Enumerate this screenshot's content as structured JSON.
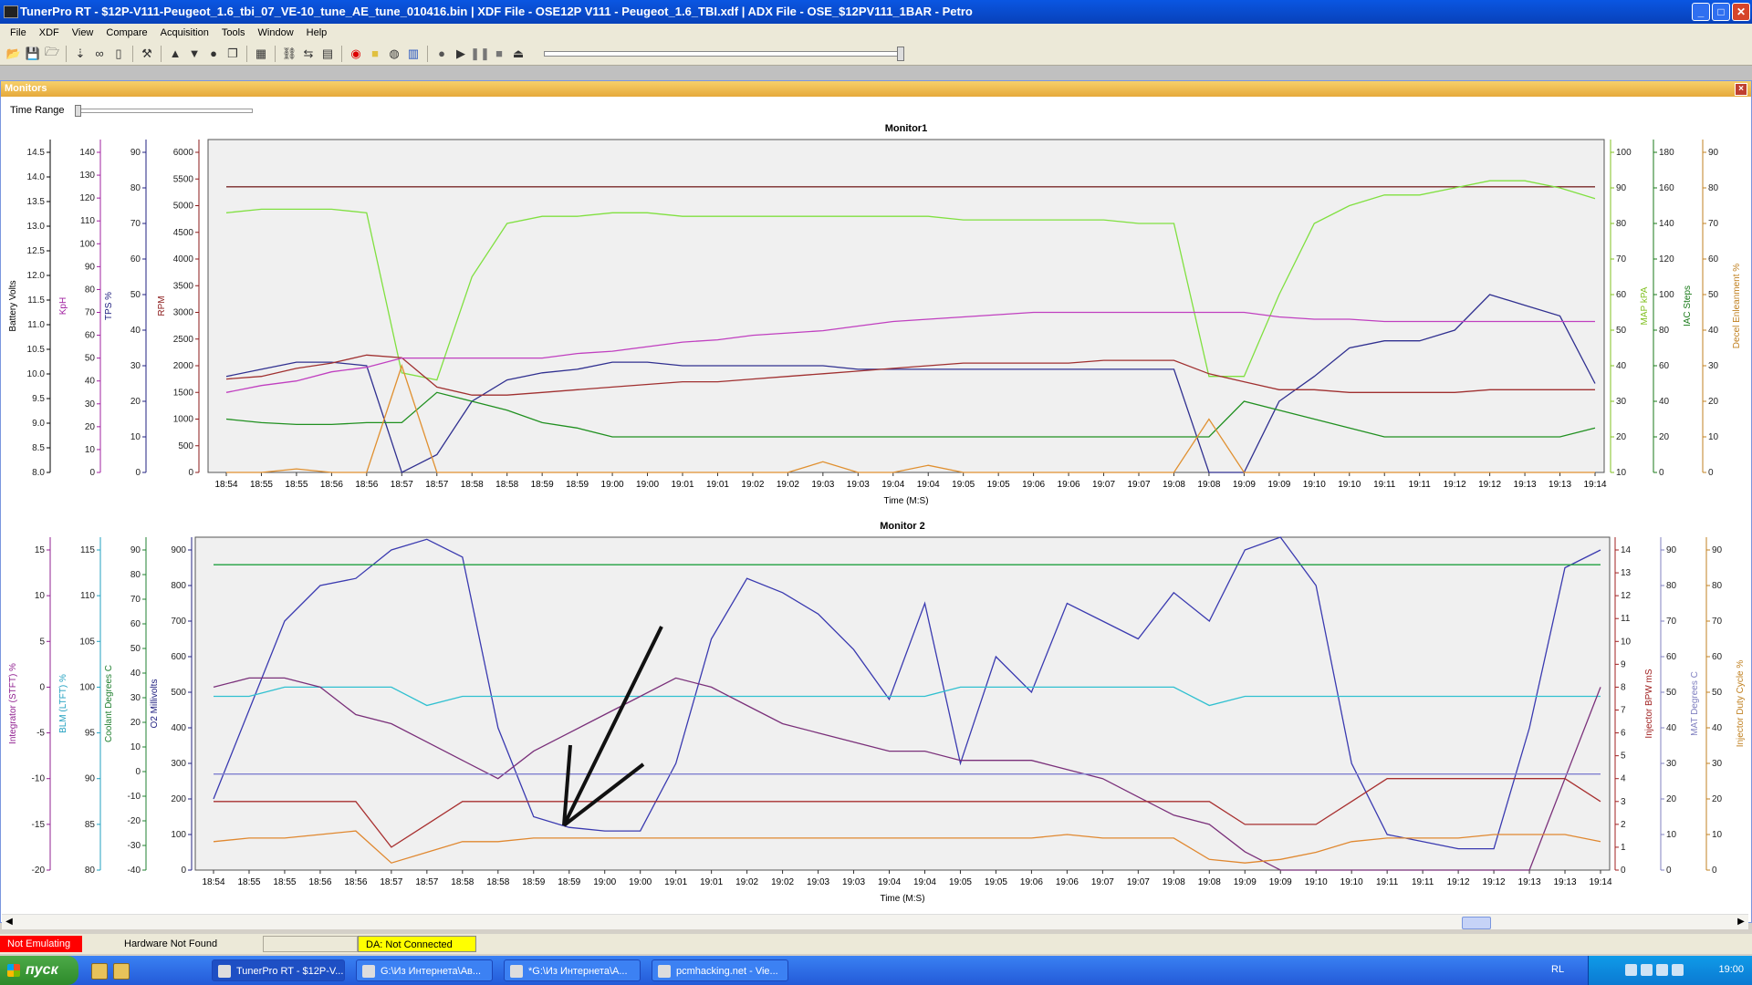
{
  "window": {
    "title": "TunerPro RT - $12P-V111-Peugeot_1.6_tbi_07_VE-10_tune_AE_tune_010416.bin | XDF File - OSE12P V111 - Peugeot_1.6_TBI.xdf | ADX File - OSE_$12PV111_1BAR - Petro"
  },
  "menu": [
    "File",
    "XDF",
    "View",
    "Compare",
    "Acquisition",
    "Tools",
    "Window",
    "Help"
  ],
  "monitors_panel": {
    "title": "Monitors",
    "time_range_label": "Time Range"
  },
  "chart_data": [
    {
      "type": "line",
      "title": "Monitor1",
      "xlabel": "Time (M:S)",
      "x": [
        "18:54",
        "18:55",
        "18:55",
        "18:56",
        "18:56",
        "18:57",
        "18:57",
        "18:58",
        "18:58",
        "18:59",
        "18:59",
        "19:00",
        "19:00",
        "19:01",
        "19:01",
        "19:02",
        "19:02",
        "19:03",
        "19:03",
        "19:04",
        "19:04",
        "19:05",
        "19:05",
        "19:06",
        "19:06",
        "19:07",
        "19:07",
        "19:08",
        "19:08",
        "19:09",
        "19:09",
        "19:10",
        "19:10",
        "19:11",
        "19:11",
        "19:12",
        "19:12",
        "19:13",
        "19:13",
        "19:14"
      ],
      "left_axes": [
        {
          "label": "Battery Volts",
          "color": "#000000",
          "ticks": [
            "14.5",
            "14.0",
            "13.5",
            "13.0",
            "12.5",
            "12.0",
            "11.5",
            "11.0",
            "10.5",
            "10.0",
            "9.5",
            "9.0",
            "8.5",
            "8.0"
          ]
        },
        {
          "label": "KpH",
          "color": "#a020a0",
          "ticks": [
            "140",
            "130",
            "120",
            "110",
            "100",
            "90",
            "80",
            "70",
            "60",
            "50",
            "40",
            "30",
            "20",
            "10",
            "0"
          ]
        },
        {
          "label": "TPS %",
          "color": "#202080",
          "ticks": [
            "90",
            "80",
            "70",
            "60",
            "50",
            "40",
            "30",
            "20",
            "10",
            "0"
          ]
        },
        {
          "label": "RPM",
          "color": "#8b1a1a",
          "ticks": [
            "6000",
            "5500",
            "5000",
            "4500",
            "4000",
            "3500",
            "3000",
            "2500",
            "2000",
            "1500",
            "1000",
            "500",
            "0"
          ]
        }
      ],
      "right_axes": [
        {
          "label": "MAP kPA",
          "color": "#80c020",
          "ticks": [
            "100",
            "90",
            "80",
            "70",
            "60",
            "50",
            "40",
            "30",
            "20",
            "10"
          ]
        },
        {
          "label": "IAC Steps",
          "color": "#1a7a1a",
          "ticks": [
            "180",
            "160",
            "140",
            "120",
            "100",
            "80",
            "60",
            "40",
            "20",
            "0"
          ]
        },
        {
          "label": "Decel Enleanment %",
          "color": "#c08020",
          "ticks": [
            "90",
            "80",
            "70",
            "60",
            "50",
            "40",
            "30",
            "20",
            "10",
            "0"
          ]
        }
      ],
      "series": [
        {
          "name": "Battery Volts",
          "color": "#7a2a2a",
          "values": [
            13.8,
            13.8,
            13.8,
            13.8,
            13.8,
            13.8,
            13.8,
            13.8,
            13.8,
            13.8,
            13.8,
            13.8,
            13.8,
            13.8,
            13.8,
            13.8,
            13.8,
            13.8,
            13.8,
            13.8,
            13.8,
            13.8,
            13.8,
            13.8,
            13.8,
            13.8,
            13.8,
            13.8,
            13.8,
            13.8,
            13.8,
            13.8,
            13.8,
            13.8,
            13.8,
            13.8,
            13.8,
            13.8,
            13.8,
            13.8
          ]
        },
        {
          "name": "MAP kPA",
          "color": "#80e040",
          "values": [
            83,
            84,
            84,
            84,
            83,
            38,
            36,
            65,
            80,
            82,
            82,
            83,
            83,
            82,
            82,
            82,
            82,
            82,
            82,
            82,
            82,
            81,
            81,
            81,
            81,
            81,
            80,
            80,
            37,
            37,
            60,
            80,
            85,
            88,
            88,
            90,
            92,
            92,
            90,
            87
          ]
        },
        {
          "name": "TPS %",
          "color": "#303090",
          "values": [
            27,
            29,
            31,
            31,
            30,
            0,
            5,
            20,
            26,
            28,
            29,
            31,
            31,
            30,
            30,
            30,
            30,
            30,
            29,
            29,
            29,
            29,
            29,
            29,
            29,
            29,
            29,
            29,
            0,
            0,
            20,
            27,
            35,
            37,
            37,
            40,
            50,
            47,
            44,
            25
          ]
        },
        {
          "name": "RPM",
          "color": "#a03030",
          "values": [
            1750,
            1800,
            1950,
            2050,
            2200,
            2150,
            1600,
            1450,
            1450,
            1500,
            1550,
            1600,
            1650,
            1700,
            1700,
            1750,
            1800,
            1850,
            1900,
            1950,
            2000,
            2050,
            2050,
            2050,
            2050,
            2100,
            2100,
            2100,
            1850,
            1700,
            1550,
            1550,
            1500,
            1500,
            1500,
            1500,
            1550,
            1550,
            1550,
            1550
          ]
        },
        {
          "name": "KpH",
          "color": "#c040c0",
          "values": [
            35,
            38,
            40,
            44,
            46,
            50,
            50,
            50,
            50,
            50,
            52,
            53,
            55,
            57,
            58,
            60,
            61,
            62,
            64,
            66,
            67,
            68,
            69,
            70,
            70,
            70,
            70,
            70,
            70,
            70,
            68,
            67,
            67,
            66,
            66,
            66,
            66,
            66,
            66,
            66
          ]
        },
        {
          "name": "IAC Steps",
          "color": "#209020",
          "values": [
            30,
            28,
            27,
            27,
            28,
            28,
            45,
            40,
            35,
            28,
            25,
            20,
            20,
            20,
            20,
            20,
            20,
            20,
            20,
            20,
            20,
            20,
            20,
            20,
            20,
            20,
            20,
            20,
            20,
            40,
            35,
            30,
            25,
            20,
            20,
            20,
            20,
            20,
            20,
            25
          ]
        },
        {
          "name": "Decel Enleanment %",
          "color": "#e09030",
          "values": [
            0,
            0,
            1,
            0,
            0,
            30,
            0,
            0,
            0,
            0,
            0,
            0,
            0,
            0,
            0,
            0,
            0,
            3,
            0,
            0,
            2,
            0,
            0,
            0,
            0,
            0,
            0,
            0,
            15,
            0,
            0,
            0,
            0,
            0,
            0,
            0,
            0,
            0,
            0,
            0
          ]
        }
      ]
    },
    {
      "type": "line",
      "title": "Monitor 2",
      "xlabel": "Time (M:S)",
      "x": [
        "18:54",
        "18:55",
        "18:55",
        "18:56",
        "18:56",
        "18:57",
        "18:57",
        "18:58",
        "18:58",
        "18:59",
        "18:59",
        "19:00",
        "19:00",
        "19:01",
        "19:01",
        "19:02",
        "19:02",
        "19:03",
        "19:03",
        "19:04",
        "19:04",
        "19:05",
        "19:05",
        "19:06",
        "19:06",
        "19:07",
        "19:07",
        "19:08",
        "19:08",
        "19:09",
        "19:09",
        "19:10",
        "19:10",
        "19:11",
        "19:11",
        "19:12",
        "19:12",
        "19:13",
        "19:13",
        "19:14"
      ],
      "left_axes": [
        {
          "label": "Integrator (STFT) %",
          "color": "#902090",
          "ticks": [
            "15",
            "10",
            "5",
            "0",
            "-5",
            "-10",
            "-15",
            "-20"
          ]
        },
        {
          "label": "BLM (LTFT) %",
          "color": "#20a0c0",
          "ticks": [
            "115",
            "110",
            "105",
            "100",
            "95",
            "90",
            "85",
            "80"
          ]
        },
        {
          "label": "Coolant Degrees C",
          "color": "#208030",
          "ticks": [
            "90",
            "80",
            "70",
            "60",
            "50",
            "40",
            "30",
            "20",
            "10",
            "0",
            "-10",
            "-20",
            "-30",
            "-40"
          ]
        },
        {
          "label": "O2 Millivolts",
          "color": "#202080",
          "ticks": [
            "900",
            "800",
            "700",
            "600",
            "500",
            "400",
            "300",
            "200",
            "100",
            "0"
          ]
        }
      ],
      "right_axes": [
        {
          "label": "Injector BPW mS",
          "color": "#a02020",
          "ticks": [
            "14",
            "13",
            "12",
            "11",
            "10",
            "9",
            "8",
            "7",
            "6",
            "5",
            "4",
            "3",
            "2",
            "1",
            "0"
          ]
        },
        {
          "label": "MAT Degrees C",
          "color": "#8080c0",
          "ticks": [
            "90",
            "80",
            "70",
            "60",
            "50",
            "40",
            "30",
            "20",
            "10",
            "0"
          ]
        },
        {
          "label": "Injector Duty Cycle %",
          "color": "#c08020",
          "ticks": [
            "90",
            "80",
            "70",
            "60",
            "50",
            "40",
            "30",
            "20",
            "10",
            "0"
          ]
        }
      ],
      "series": [
        {
          "name": "O2 Millivolts",
          "color": "#3a3ab0",
          "values": [
            200,
            450,
            700,
            800,
            820,
            900,
            930,
            880,
            400,
            150,
            120,
            110,
            110,
            300,
            650,
            820,
            780,
            720,
            620,
            480,
            750,
            300,
            600,
            500,
            750,
            700,
            650,
            780,
            700,
            900,
            940,
            800,
            300,
            100,
            80,
            60,
            60,
            400,
            850,
            900
          ]
        },
        {
          "name": "Coolant Degrees C",
          "color": "#20a040",
          "values": [
            84,
            84,
            84,
            84,
            84,
            84,
            84,
            84,
            84,
            84,
            84,
            84,
            84,
            84,
            84,
            84,
            84,
            84,
            84,
            84,
            84,
            84,
            84,
            84,
            84,
            84,
            84,
            84,
            84,
            84,
            84,
            84,
            84,
            84,
            84,
            84,
            84,
            84,
            84,
            84
          ]
        },
        {
          "name": "BLM (LTFT) %",
          "color": "#30c0d0",
          "values": [
            99,
            99,
            100,
            100,
            100,
            100,
            98,
            99,
            99,
            99,
            99,
            99,
            99,
            99,
            99,
            99,
            99,
            99,
            99,
            99,
            99,
            100,
            100,
            100,
            100,
            100,
            100,
            100,
            98,
            99,
            99,
            99,
            99,
            99,
            99,
            99,
            99,
            99,
            99,
            99
          ]
        },
        {
          "name": "Integrator (STFT) %",
          "color": "#7a307a",
          "values": [
            0,
            1,
            1,
            0,
            -3,
            -4,
            -6,
            -8,
            -10,
            -7,
            -5,
            -3,
            -1,
            1,
            0,
            -2,
            -4,
            -5,
            -6,
            -7,
            -7,
            -8,
            -8,
            -8,
            -9,
            -10,
            -12,
            -14,
            -15,
            -18,
            -20,
            -20,
            -20,
            -20,
            -20,
            -20,
            -20,
            -20,
            -10,
            0
          ]
        },
        {
          "name": "Injector BPW mS",
          "color": "#a83030",
          "values": [
            3,
            3,
            3,
            3,
            3,
            1,
            2,
            3,
            3,
            3,
            3,
            3,
            3,
            3,
            3,
            3,
            3,
            3,
            3,
            3,
            3,
            3,
            3,
            3,
            3,
            3,
            3,
            3,
            3,
            2,
            2,
            2,
            3,
            4,
            4,
            4,
            4,
            4,
            4,
            3
          ]
        },
        {
          "name": "MAT Degrees C",
          "color": "#8080d0",
          "values": [
            27,
            27,
            27,
            27,
            27,
            27,
            27,
            27,
            27,
            27,
            27,
            27,
            27,
            27,
            27,
            27,
            27,
            27,
            27,
            27,
            27,
            27,
            27,
            27,
            27,
            27,
            27,
            27,
            27,
            27,
            27,
            27,
            27,
            27,
            27,
            27,
            27,
            27,
            27,
            27
          ]
        },
        {
          "name": "Injector Duty Cycle %",
          "color": "#e08830",
          "values": [
            8,
            9,
            9,
            10,
            11,
            2,
            5,
            8,
            8,
            9,
            9,
            9,
            9,
            9,
            9,
            9,
            9,
            9,
            9,
            9,
            9,
            9,
            9,
            9,
            10,
            9,
            9,
            9,
            3,
            2,
            3,
            5,
            8,
            9,
            9,
            9,
            10,
            10,
            10,
            8
          ]
        }
      ]
    }
  ],
  "status": {
    "emulating": "Not Emulating",
    "hardware": "Hardware Not Found",
    "da": "DA: Not Connected"
  },
  "taskbar": {
    "start": "пуск",
    "tasks": [
      "TunerPro RT - $12P-V...",
      "G:\\Из Интернета\\Ав...",
      "*G:\\Из Интернета\\А...",
      "pcmhacking.net - Vie..."
    ],
    "lang": "RL",
    "clock": "19:00"
  },
  "colors": {
    "plot_bg": "#f0f0f0",
    "status_red": "#ff0000",
    "status_yellow": "#ffff00"
  }
}
